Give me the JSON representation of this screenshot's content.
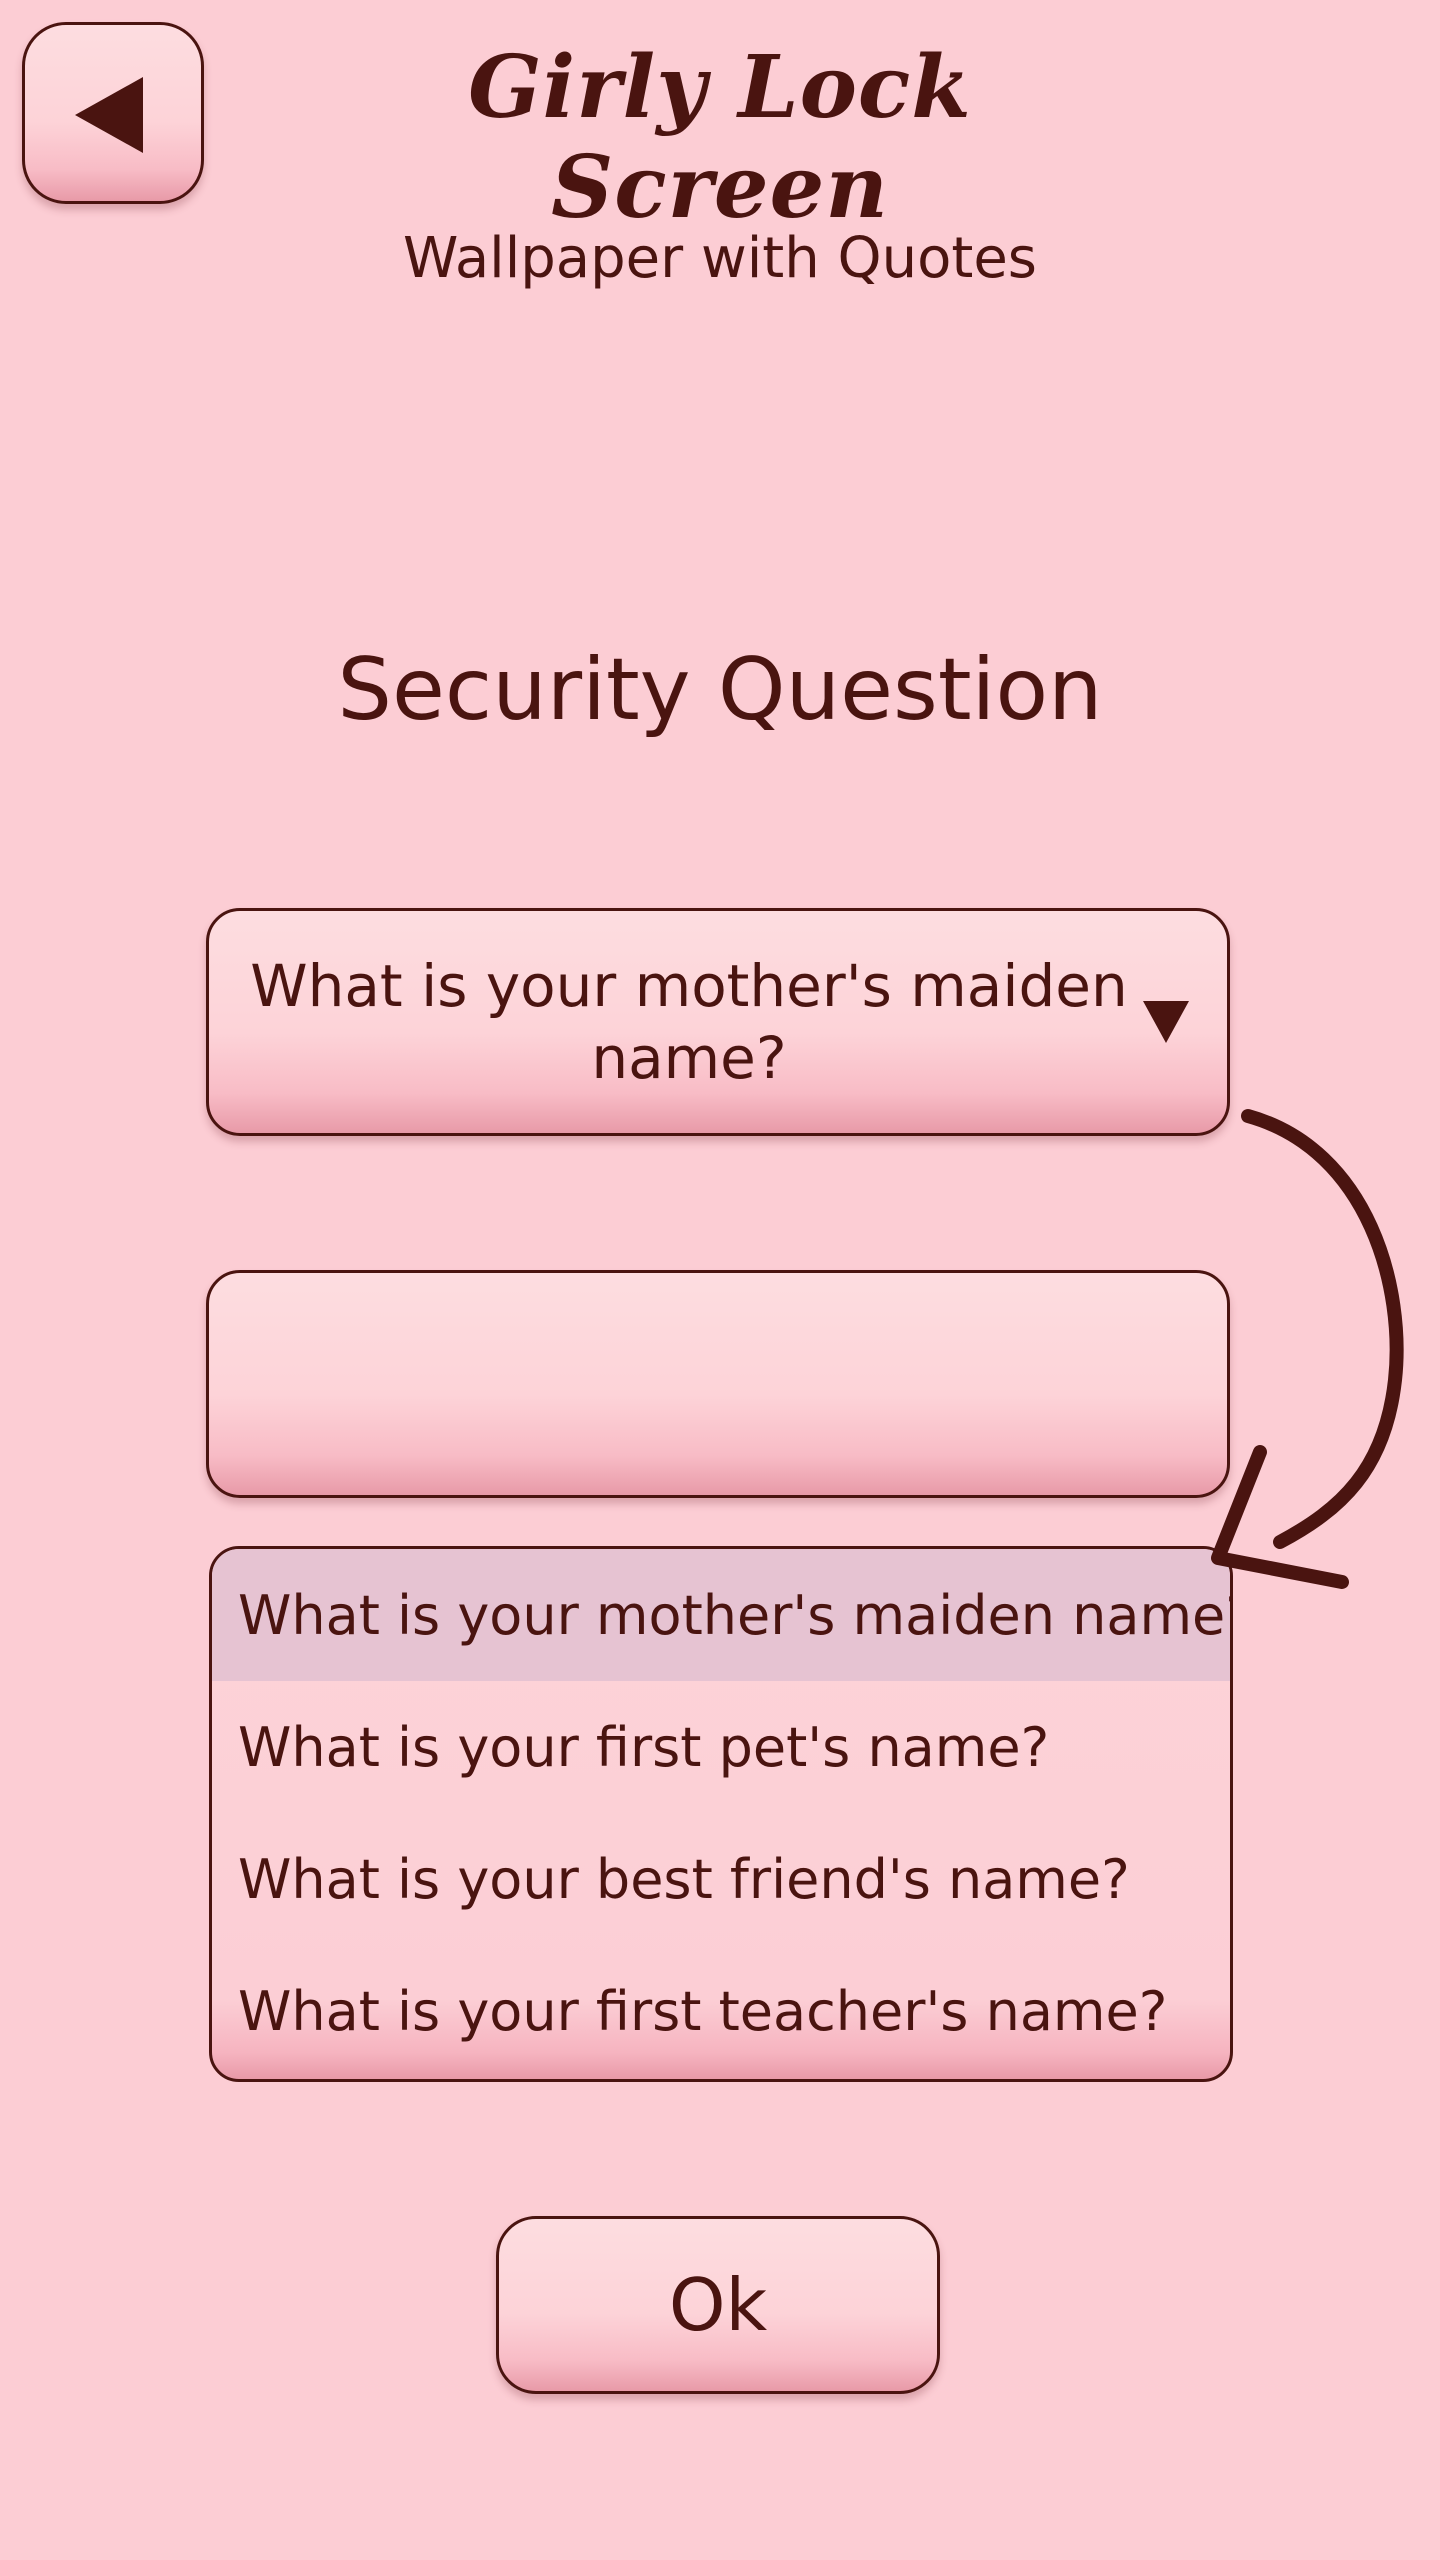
{
  "header": {
    "back_icon": "back-triangle-icon",
    "title_line1": "Girly Lock Screen",
    "title_line2": "Wallpaper with Quotes"
  },
  "heading": "Security Question",
  "question_select": {
    "selected": "What is your mother's maiden name?",
    "caret_icon": "caret-down-icon"
  },
  "answer_input": {
    "value": "",
    "placeholder": ""
  },
  "question_options": [
    {
      "label": "What is your mother's maiden name?",
      "selected": true
    },
    {
      "label": "What is your first pet's name?",
      "selected": false
    },
    {
      "label": "What is your best friend's name?",
      "selected": false
    },
    {
      "label": "What is your first teacher's name?",
      "selected": false
    }
  ],
  "hint_arrow_icon": "curved-arrow-icon",
  "ok_button": {
    "label": "Ok"
  },
  "colors": {
    "background": "#fccdd4",
    "text": "#4a1410",
    "button_fill": "#fdd3d8",
    "selected_option": "#e6c3d2"
  }
}
